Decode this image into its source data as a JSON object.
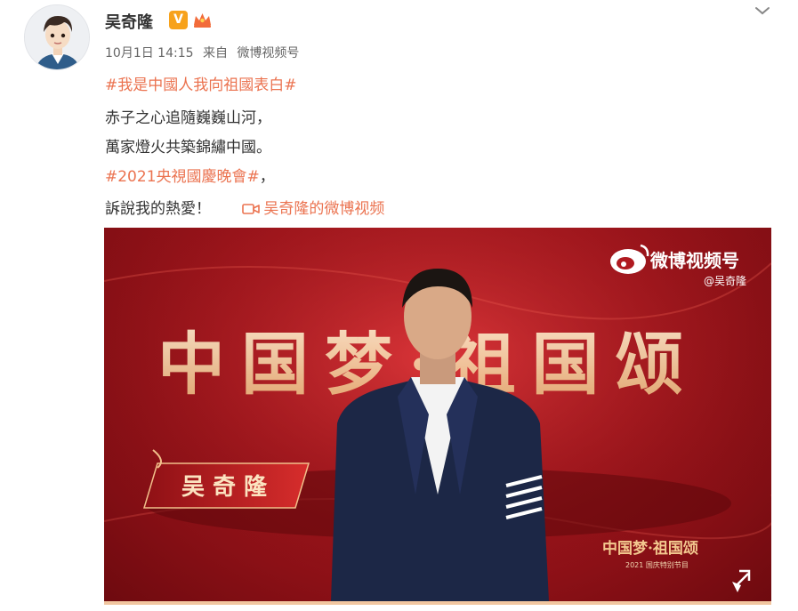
{
  "post": {
    "author": "吴奇隆",
    "time": "10月1日 14:15",
    "source_prefix": "来自",
    "source": "微博视频号",
    "hashtag1": "#我是中國人我向祖國表白#",
    "line2": "赤子之心追隨巍巍山河，",
    "line3": "萬家燈火共築錦繡中國。",
    "hashtag2": "#2021央視國慶晚會#",
    "hashtag2_suffix": "，",
    "line5": "訴說我的熱愛！",
    "video_link": "吴奇隆的微博视频"
  },
  "video": {
    "watermark_title": "微博视频号",
    "watermark_handle": "@吴奇隆",
    "bg_calligraphy": "中国梦·祖国颂",
    "name_plate": "吴 奇 隆",
    "corner_logo_title": "中国梦·祖国颂",
    "corner_logo_sub": "2021 国庆特别节目"
  },
  "colors": {
    "link": "#eb7350",
    "badge": "#f7a21b",
    "video_red": "#b01a20"
  },
  "icons": [
    "chevron-down-icon",
    "verified-v-icon",
    "crown-badge-icon",
    "video-camera-icon",
    "weibo-logo-icon",
    "fullscreen-icon"
  ]
}
